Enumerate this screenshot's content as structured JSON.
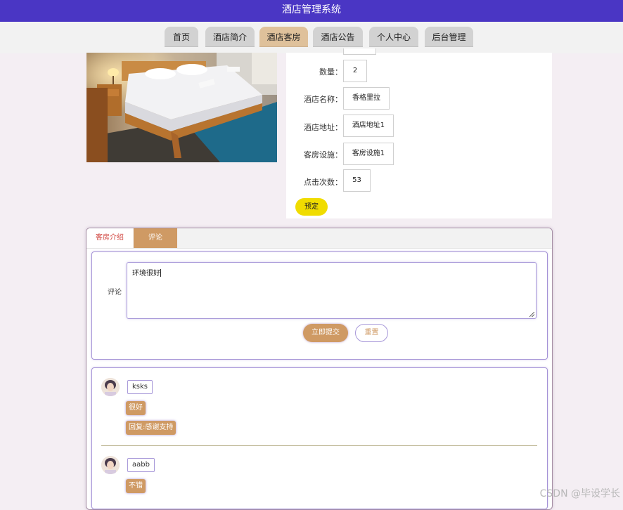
{
  "app": {
    "title": "酒店管理系统"
  },
  "nav": {
    "items": [
      {
        "label": "首页"
      },
      {
        "label": "酒店简介"
      },
      {
        "label": "酒店客房",
        "active": true
      },
      {
        "label": "酒店公告"
      },
      {
        "label": "个人中心"
      },
      {
        "label": "后台管理"
      }
    ]
  },
  "room": {
    "fields": [
      {
        "label": "数量：",
        "value": "2"
      },
      {
        "label": "酒店名称：",
        "value": "香格里拉"
      },
      {
        "label": "酒店地址：",
        "value": "酒店地址1"
      },
      {
        "label": "客房设施：",
        "value": "客房设施1"
      },
      {
        "label": "点击次数：",
        "value": "53"
      }
    ],
    "book_label": "预定"
  },
  "tabs": {
    "intro": "客房介绍",
    "comments": "评论"
  },
  "comment_form": {
    "label": "评论",
    "value": "环境很好",
    "submit_label": "立即提交",
    "reset_label": "重置"
  },
  "comments": [
    {
      "user": "ksks",
      "text": "很好",
      "reply": "回复:感谢支持"
    },
    {
      "user": "aabb",
      "text": "不错"
    }
  ],
  "colors": {
    "header": "#4a36c4",
    "accent": "#cf9a64",
    "book": "#f0dc00",
    "active_tab": "#dfc19b"
  },
  "watermark": "CSDN @毕设学长"
}
